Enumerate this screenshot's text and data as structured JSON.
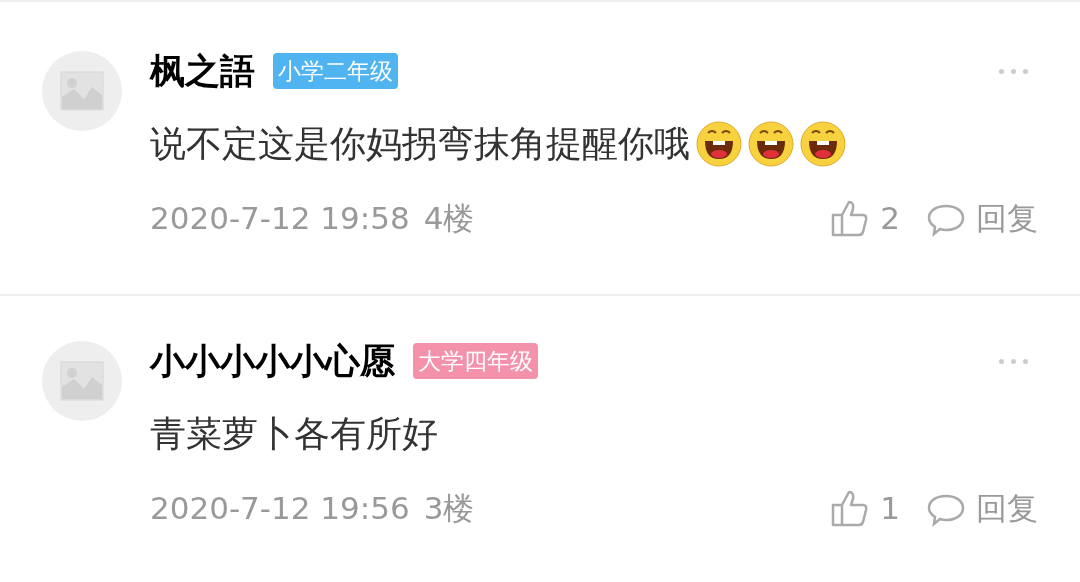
{
  "comments": [
    {
      "name": "枫之語",
      "badge": {
        "label": "小学二年级",
        "color": "#4fb4f0"
      },
      "text": "说不定这是你妈拐弯抹角提醒你哦",
      "emojis": [
        {
          "kind": "laugh"
        },
        {
          "kind": "laugh"
        },
        {
          "kind": "laugh"
        }
      ],
      "time": "2020-7-12 19:58",
      "floor": "4楼",
      "likes": "2",
      "reply": "回复"
    },
    {
      "name": "小小小小小心愿",
      "badge": {
        "label": "大学四年级",
        "color": "#f492ac"
      },
      "text": "青菜萝卜各有所好",
      "time": "2020-7-12 19:56",
      "floor": "3楼",
      "likes": "1",
      "reply": "回复"
    }
  ]
}
